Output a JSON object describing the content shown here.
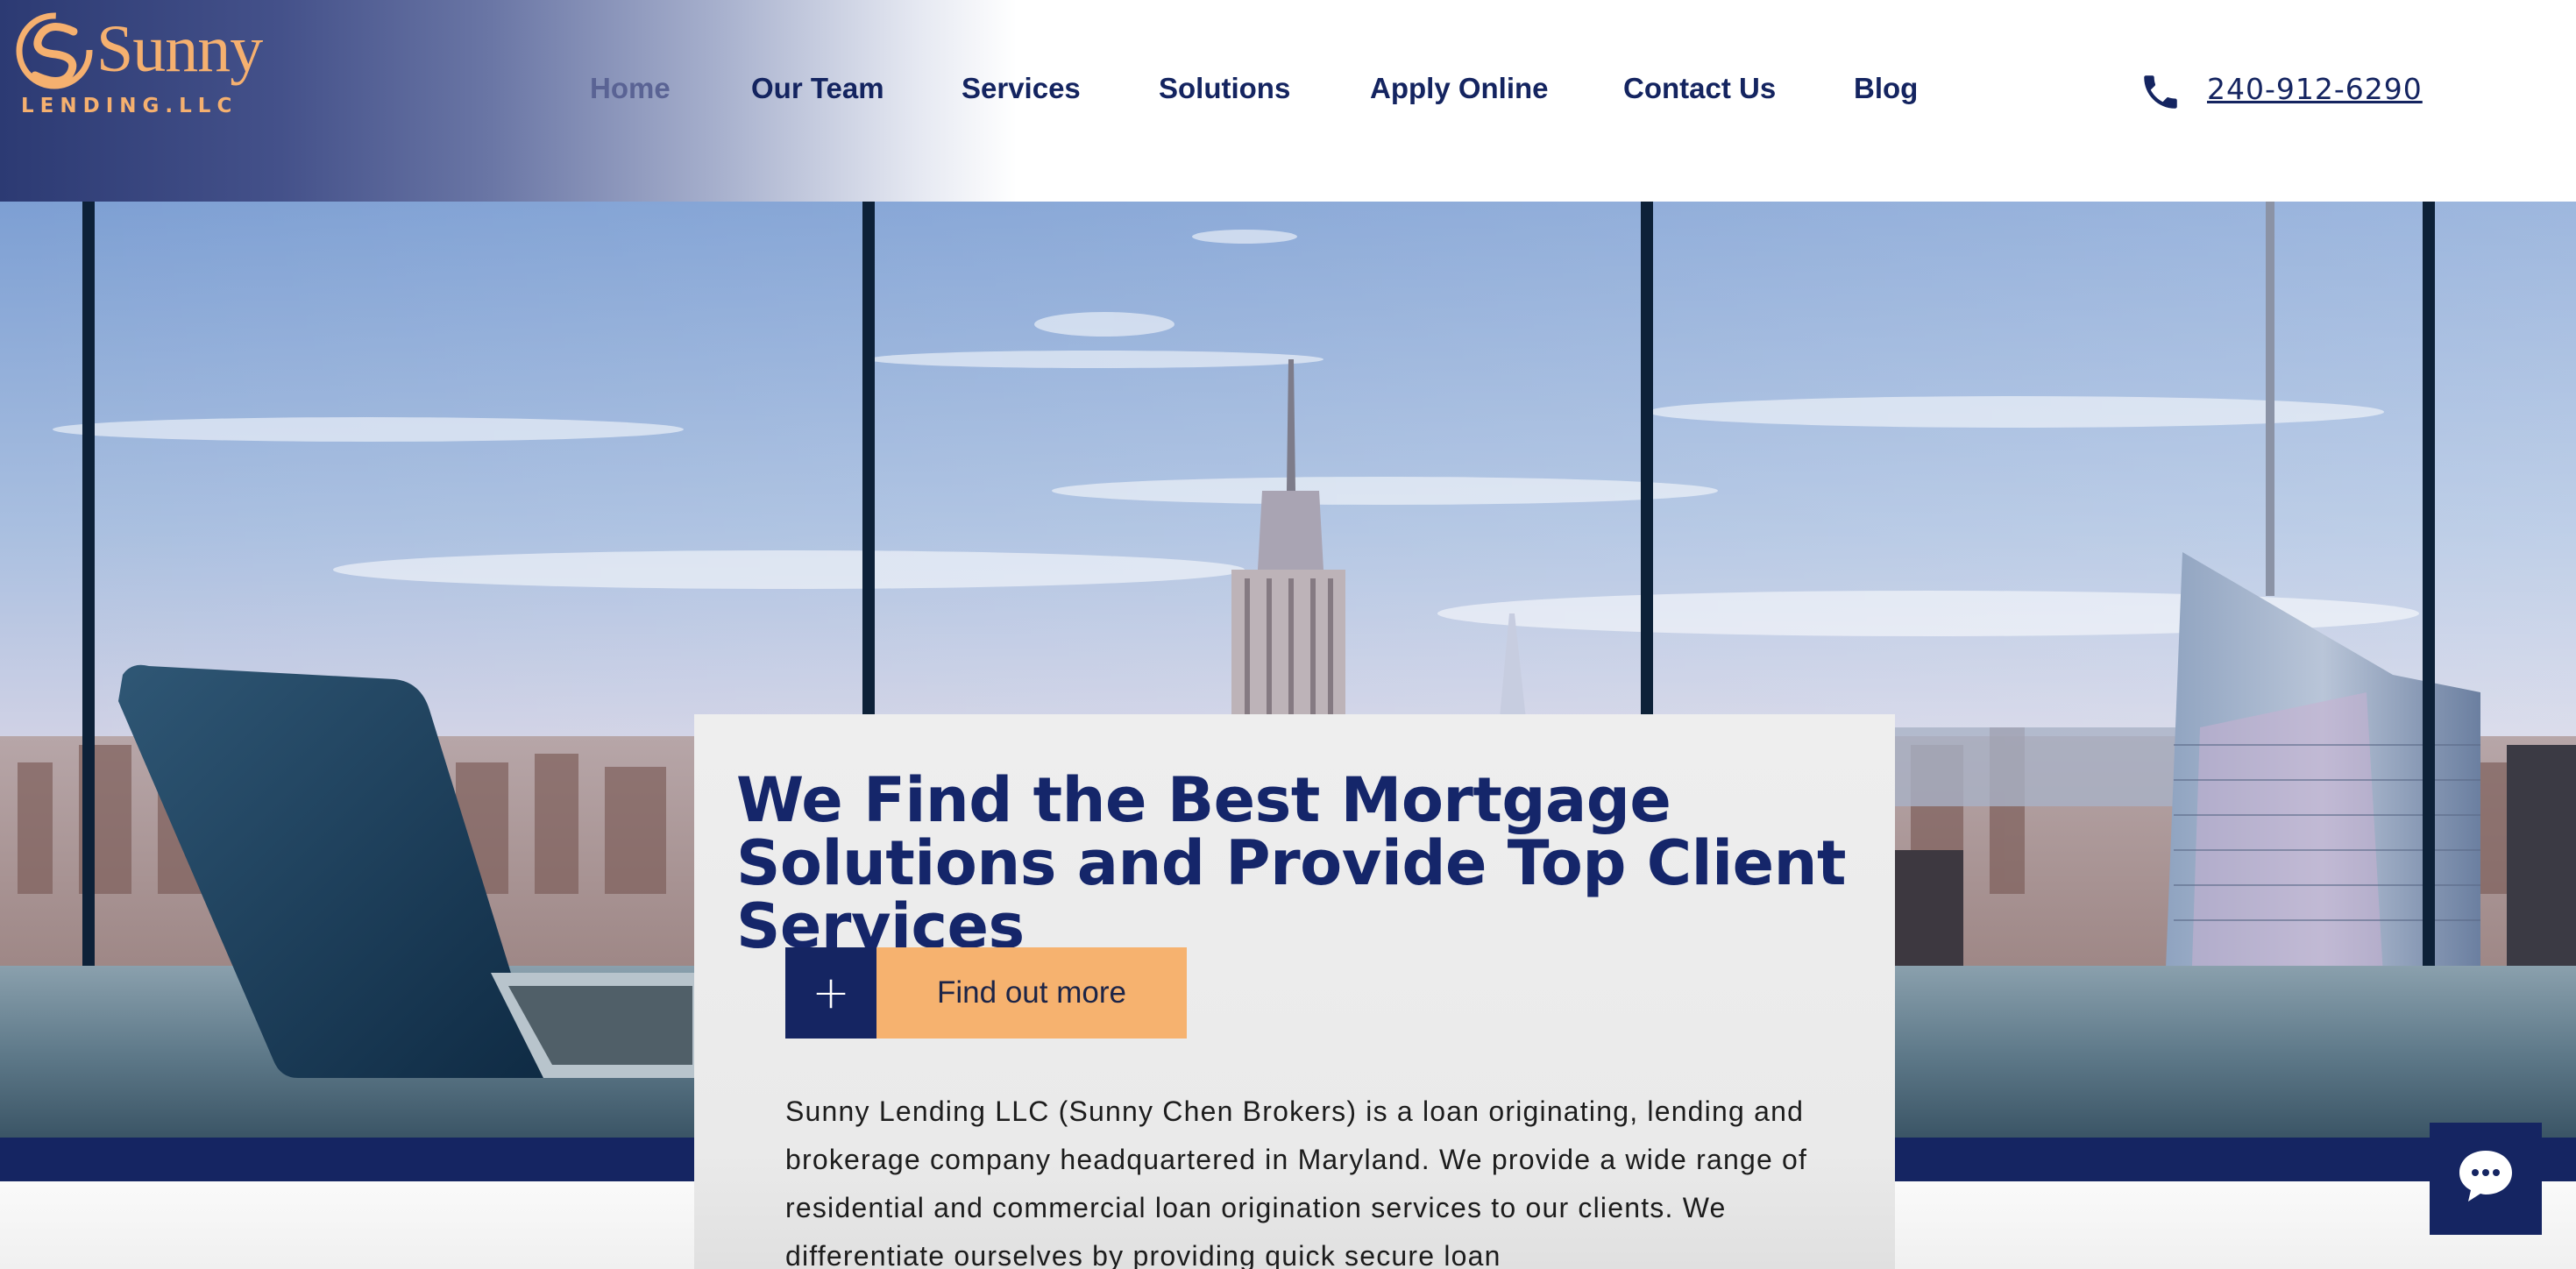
{
  "brand": {
    "name": "Sunny",
    "subtitle": "LENDING.LLC",
    "color": "#f5b06f"
  },
  "nav": {
    "items": [
      {
        "label": "Home",
        "active": true
      },
      {
        "label": "Our Team"
      },
      {
        "label": "Services"
      },
      {
        "label": "Solutions"
      },
      {
        "label": "Apply Online"
      },
      {
        "label": "Contact Us"
      },
      {
        "label": "Blog"
      }
    ],
    "phone": "240-912-6290",
    "phone_icon": "phone-icon"
  },
  "hero": {
    "title": "We Find the Best Mortgage Solutions and Provide Top Client Services",
    "cta_icon": "+",
    "cta_label": "Find out more",
    "body": "Sunny Lending LLC (Sunny Chen Brokers) is a loan originating, lending and brokerage company headquartered in Maryland. We provide a wide range of residential and commercial loan origination services to our clients. We differentiate ourselves by providing quick secure loan"
  },
  "chat": {
    "icon": "chat-bubble-icon"
  },
  "colors": {
    "navy": "#152562",
    "accent": "#f6b26f",
    "card": "#eeeeee"
  }
}
